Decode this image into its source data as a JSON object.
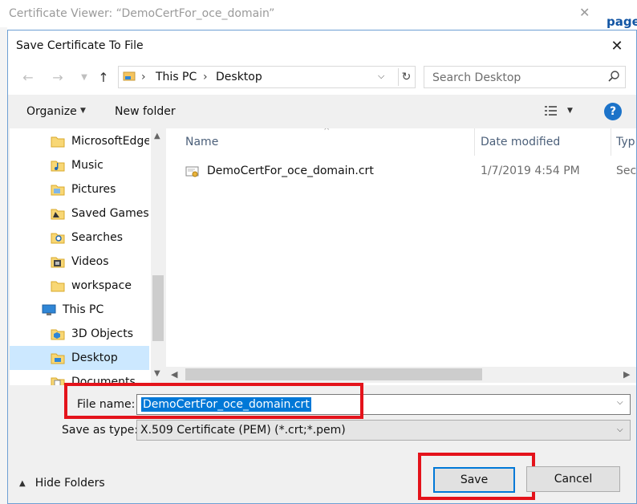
{
  "background": {
    "title": "Certificate Viewer: “DemoCertFor_oce_domain”",
    "page_link": "page"
  },
  "dialog": {
    "title": "Save Certificate To File",
    "address": {
      "crumbs": [
        "This PC",
        "Desktop"
      ]
    },
    "search": {
      "placeholder": "Search Desktop"
    },
    "toolbar": {
      "organize": "Organize",
      "new_folder": "New folder"
    },
    "nav_items": [
      {
        "label": "MicrosoftEdgeB",
        "icon": "folder-icon"
      },
      {
        "label": "Music",
        "icon": "music-folder-icon"
      },
      {
        "label": "Pictures",
        "icon": "pictures-folder-icon"
      },
      {
        "label": "Saved Games",
        "icon": "saved-games-icon"
      },
      {
        "label": "Searches",
        "icon": "searches-icon"
      },
      {
        "label": "Videos",
        "icon": "videos-folder-icon"
      },
      {
        "label": "workspace",
        "icon": "folder-icon"
      },
      {
        "label": "This PC",
        "icon": "pc-icon"
      },
      {
        "label": "3D Objects",
        "icon": "3d-objects-icon"
      },
      {
        "label": "Desktop",
        "icon": "desktop-folder-icon",
        "selected": true
      },
      {
        "label": "Documents",
        "icon": "documents-folder-icon"
      }
    ],
    "columns": {
      "name": "Name",
      "date_modified": "Date modified",
      "type": "Typ"
    },
    "files": [
      {
        "name": "DemoCertFor_oce_domain.crt",
        "date": "1/7/2019 4:54 PM",
        "type": "Sec"
      }
    ],
    "file_name_label": "File name:",
    "file_name_value": "DemoCertFor_oce_domain.crt",
    "save_as_type_label": "Save as type:",
    "save_as_type_value": "X.509 Certificate (PEM) (*.crt;*.pem)",
    "hide_folders": "Hide Folders",
    "save_button": "Save",
    "cancel_button": "Cancel"
  },
  "colors": {
    "accent": "#0078d7",
    "highlight_box": "#e4131b",
    "selected_nav": "#cce8ff"
  }
}
